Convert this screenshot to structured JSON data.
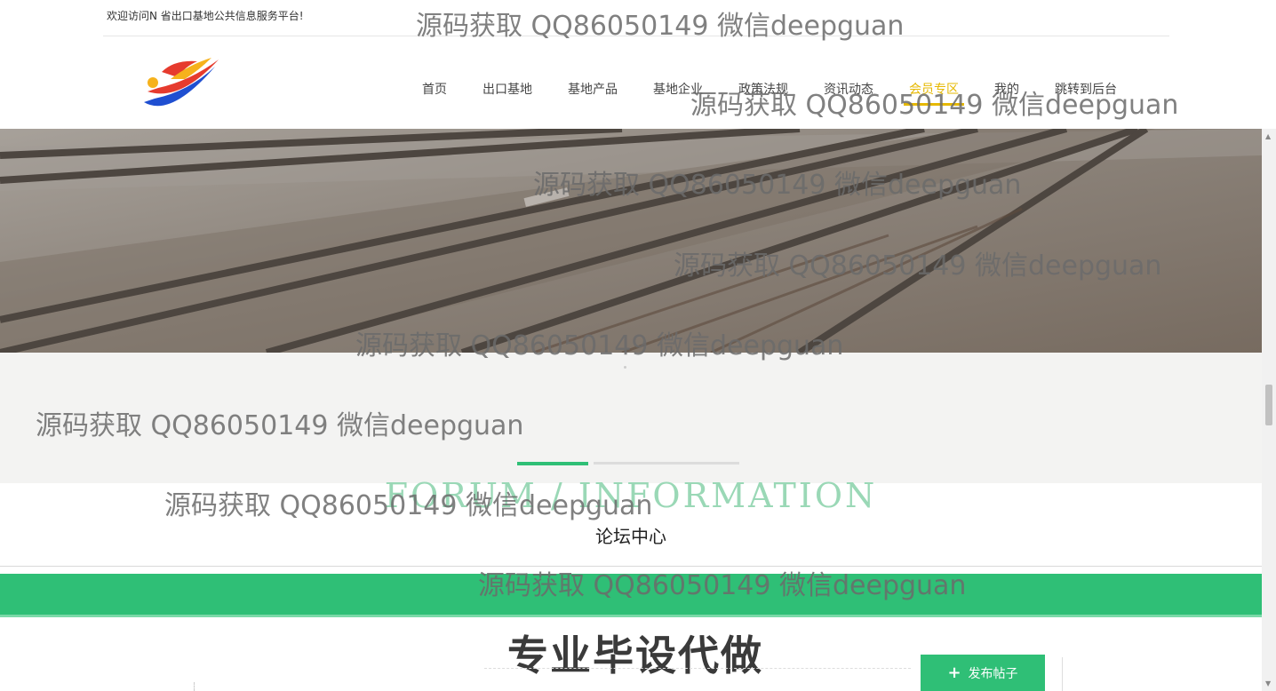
{
  "topbar": {
    "welcome": "欢迎访问N 省出口基地公共信息服务平台!"
  },
  "nav": {
    "items": [
      "首页",
      "出口基地",
      "基地产品",
      "基地企业",
      "政策法规",
      "资讯动态",
      "会员专区",
      "我的",
      "跳转到后台"
    ],
    "active_index": 6
  },
  "section": {
    "title_en": "FORUM / INFORMATION",
    "title_cn": "论坛中心"
  },
  "promo": {
    "text": "专业毕设代做"
  },
  "actions": {
    "post_label": "发布帖子",
    "post_icon": "plus-icon"
  },
  "watermark": {
    "text": "源码获取 QQ86050149 微信deepguan"
  },
  "colors": {
    "accent_green": "#2fbf76",
    "nav_active": "#e6b800"
  }
}
